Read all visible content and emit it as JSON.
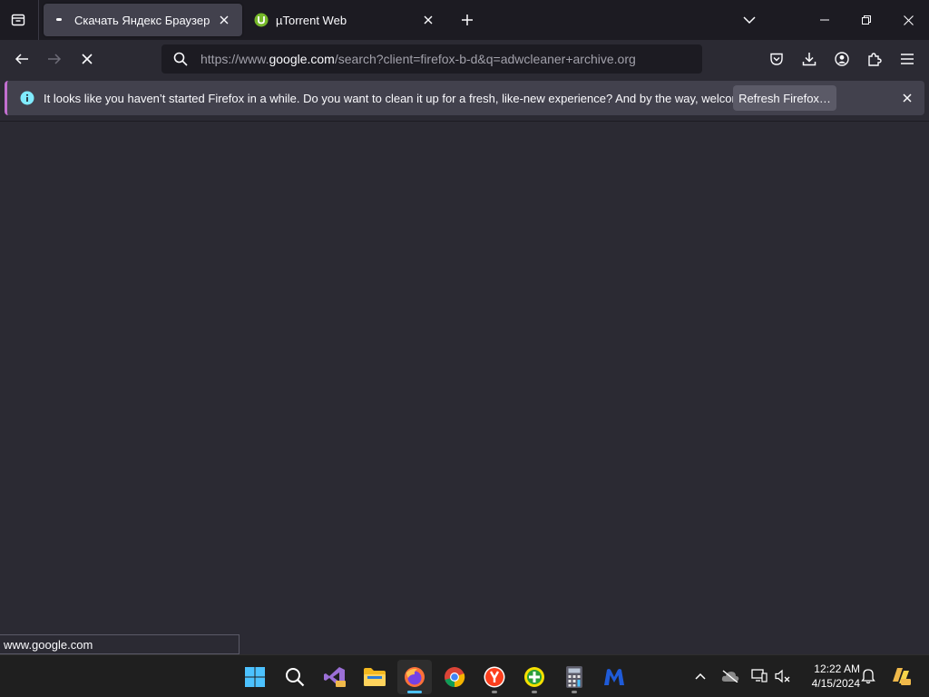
{
  "tabs": [
    {
      "title": "Скачать Яндекс Браузер",
      "active": true
    },
    {
      "title": "µTorrent Web",
      "active": false
    }
  ],
  "url": {
    "prefix": "https://www.",
    "host": "google.com",
    "path": "/search?client=firefox-b-d&q=adwcleaner+archive.org"
  },
  "notification": {
    "message": "It looks like you haven’t started Firefox in a while. Do you want to clean it up for a fresh, like-new experience? And by the way, welcome back!",
    "button_label": "Refresh Firefox…"
  },
  "status_text": "www.google.com",
  "clock": {
    "time": "12:22 AM",
    "date": "4/15/2024"
  },
  "taskbar": {
    "apps": [
      "start",
      "search",
      "visual-studio-preview",
      "file-explorer",
      "firefox",
      "chrome",
      "yandex-browser",
      "green-app",
      "calculator",
      "malwarebytes"
    ]
  },
  "colors": {
    "bg": "#2b2a33",
    "tabstrip": "#1c1b22",
    "accent": "#4cc2ff",
    "notif_border": "#c26fd0"
  }
}
